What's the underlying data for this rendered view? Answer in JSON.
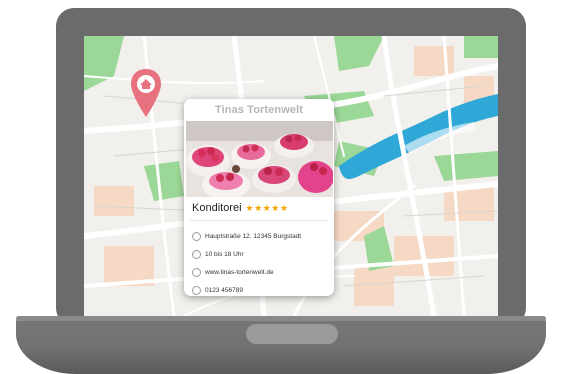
{
  "card": {
    "title": "Tinas Tortenwelt",
    "category": "Konditorei",
    "stars": "★★★★★",
    "rating": 5,
    "address": "Hauptstraße 12. 12345 Burgstadt",
    "hours": "10 bis 18 Uhr",
    "website": "www.tinas-tortenwelt.de",
    "phone": "0123 456789"
  },
  "icons": {
    "pin": "home-map-pin-icon",
    "address": "location-icon",
    "hours": "clock-icon",
    "website": "globe-icon",
    "phone": "phone-icon"
  },
  "colors": {
    "pin": "#e8717f",
    "star": "#f2a400",
    "river": "#2fa8d8",
    "park": "#8fd18b",
    "laptop": "#6b6b6b"
  }
}
